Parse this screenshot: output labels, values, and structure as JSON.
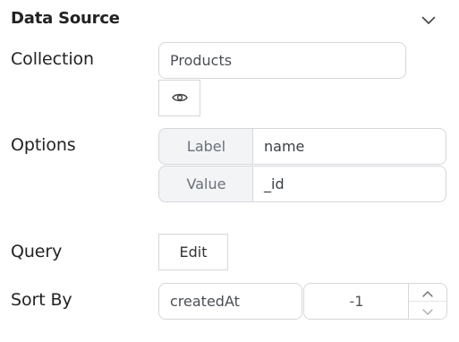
{
  "section": {
    "title": "Data Source"
  },
  "collection": {
    "label": "Collection",
    "value": "Products"
  },
  "options": {
    "label": "Options",
    "label_addon": "Label",
    "label_value": "name",
    "value_addon": "Value",
    "value_value": "_id"
  },
  "query": {
    "label": "Query",
    "button_label": "Edit"
  },
  "sort": {
    "label": "Sort By",
    "field_value": "createdAt",
    "order_value": "-1"
  },
  "colors": {
    "border": "#d5d7db",
    "addon_bg": "#f3f4f6",
    "text": "#222222"
  }
}
